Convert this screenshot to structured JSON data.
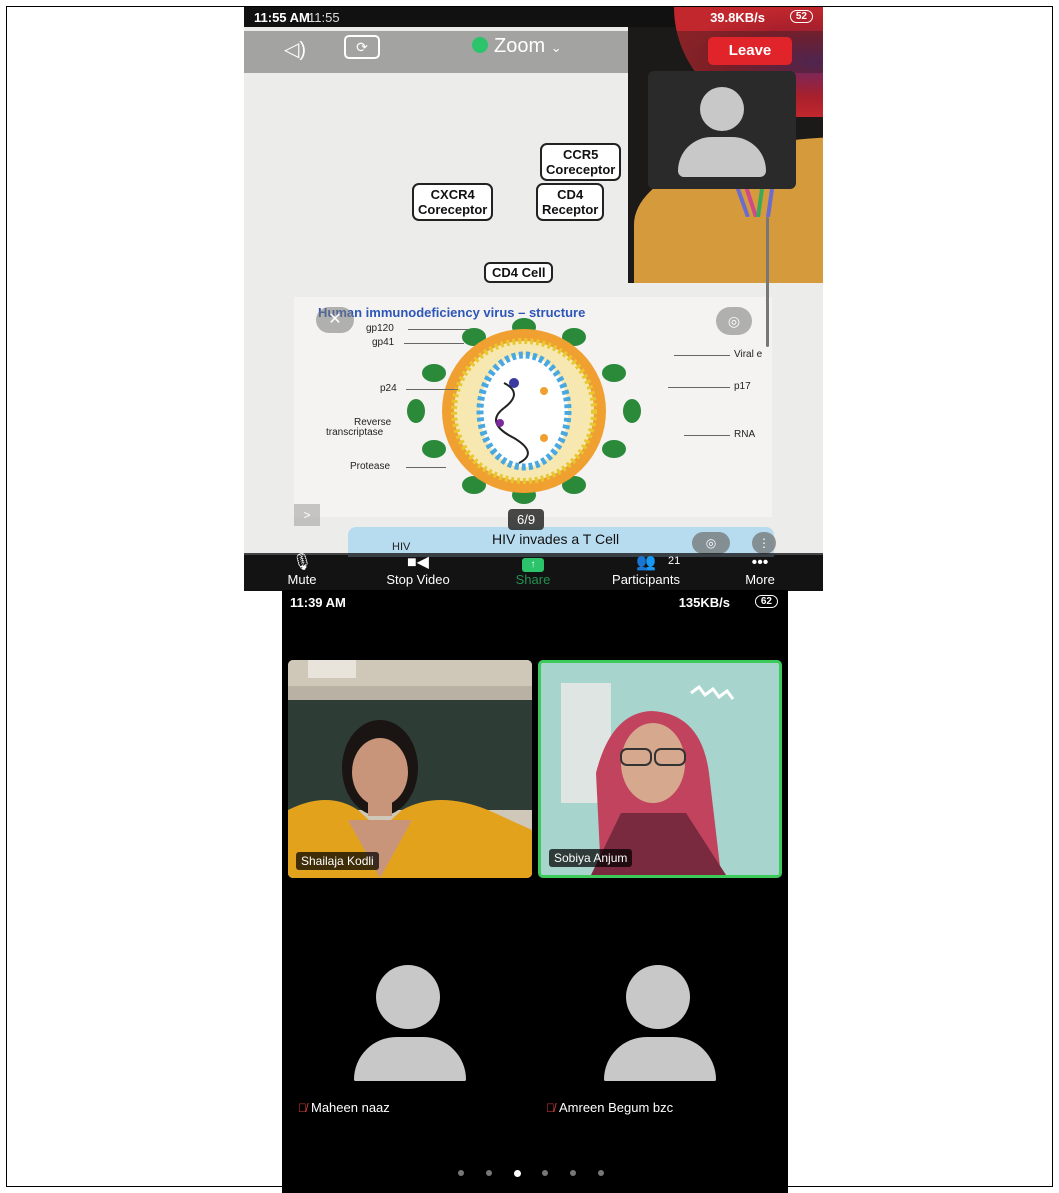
{
  "meeting_share": {
    "status_bar": {
      "time": "11:55 AM",
      "time_secondary": "11:55",
      "network": "39.8KB/s",
      "battery": "52"
    },
    "app_title": "Zoom",
    "leave_label": "Leave",
    "slide_top": {
      "ccr5": [
        "CCR5",
        "Coreceptor"
      ],
      "cxcr4": [
        "CXCR4",
        "Coreceptor"
      ],
      "cd4": [
        "CD4",
        "Receptor"
      ],
      "cd4_cell": "CD4 Cell"
    },
    "slide_diagram": {
      "title": "Human immunodeficiency virus – structure",
      "labels_left": [
        "gp120",
        "gp41",
        "p24",
        "Reverse",
        "transcriptase",
        "Protease"
      ],
      "labels_right": [
        "Viral e",
        "p17",
        "RNA"
      ]
    },
    "next_slide": {
      "title": "HIV invades a T Cell",
      "hiv_label": "HIV"
    },
    "page_indicator": "6/9",
    "toolbar": {
      "mute": "Mute",
      "stop_video": "Stop Video",
      "share": "Share",
      "participants": "Participants",
      "participants_count": "21",
      "more": "More"
    }
  },
  "meeting_gallery": {
    "status_bar": {
      "time": "11:39 AM",
      "network": "135KB/s",
      "battery": "62"
    },
    "participants": [
      {
        "name": "Shailaja Kodli",
        "video": true
      },
      {
        "name": "Sobiya Anjum",
        "video": true,
        "active_speaker": true
      },
      {
        "name": "Maheen naaz",
        "video": false,
        "muted": true
      },
      {
        "name": "Amreen Begum bzc",
        "video": false,
        "muted": true
      }
    ],
    "page_dots": {
      "count": 6,
      "active_index": 2
    }
  }
}
